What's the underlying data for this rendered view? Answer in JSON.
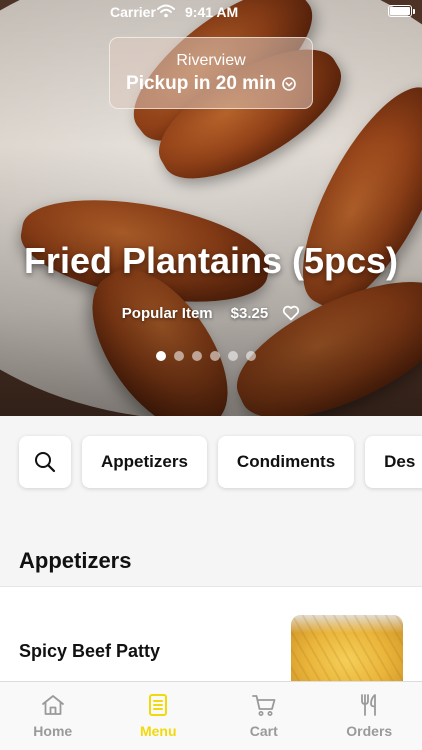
{
  "status_bar": {
    "carrier": "Carrier",
    "time": "9:41 AM"
  },
  "location": {
    "name": "Riverview",
    "pickup": "Pickup in 20 min"
  },
  "hero": {
    "title": "Fried Plantains (5pcs)",
    "tag": "Popular Item",
    "price": "$3.25",
    "slide_count": 6,
    "active_slide": 1
  },
  "categories": [
    "Appetizers",
    "Condiments",
    "Des"
  ],
  "section": {
    "title": "Appetizers"
  },
  "items": [
    {
      "name": "Spicy Beef Patty"
    }
  ],
  "tabs": [
    {
      "label": "Home",
      "icon": "home-icon"
    },
    {
      "label": "Menu",
      "icon": "menu-icon"
    },
    {
      "label": "Cart",
      "icon": "cart-icon"
    },
    {
      "label": "Orders",
      "icon": "utensils-icon"
    }
  ],
  "active_tab": "Menu",
  "colors": {
    "accent": "#f2d90b",
    "inactive": "#9a9a9a"
  }
}
